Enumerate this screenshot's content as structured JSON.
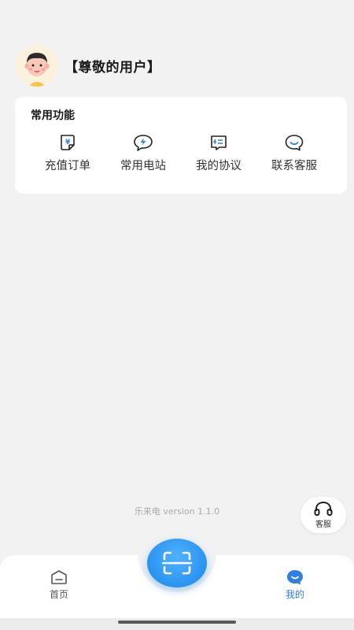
{
  "profile": {
    "username": "【尊敬的用户】"
  },
  "functions": {
    "title": "常用功能",
    "items": [
      {
        "label": "充值订单",
        "icon": "recharge-order-icon"
      },
      {
        "label": "常用电站",
        "icon": "power-station-icon"
      },
      {
        "label": "我的协议",
        "icon": "agreement-icon"
      },
      {
        "label": "联系客服",
        "icon": "customer-service-icon"
      }
    ]
  },
  "version_text": "乐来电 version 1.1.0",
  "service_button": {
    "label": "客服",
    "icon": "headset-icon"
  },
  "nav": {
    "home": {
      "label": "首页",
      "icon": "home-icon"
    },
    "mine": {
      "label": "我的",
      "icon": "mine-icon"
    },
    "scan": {
      "icon": "scan-icon"
    }
  },
  "colors": {
    "accent": "#2e7fe0",
    "background": "#f2f2f2"
  }
}
